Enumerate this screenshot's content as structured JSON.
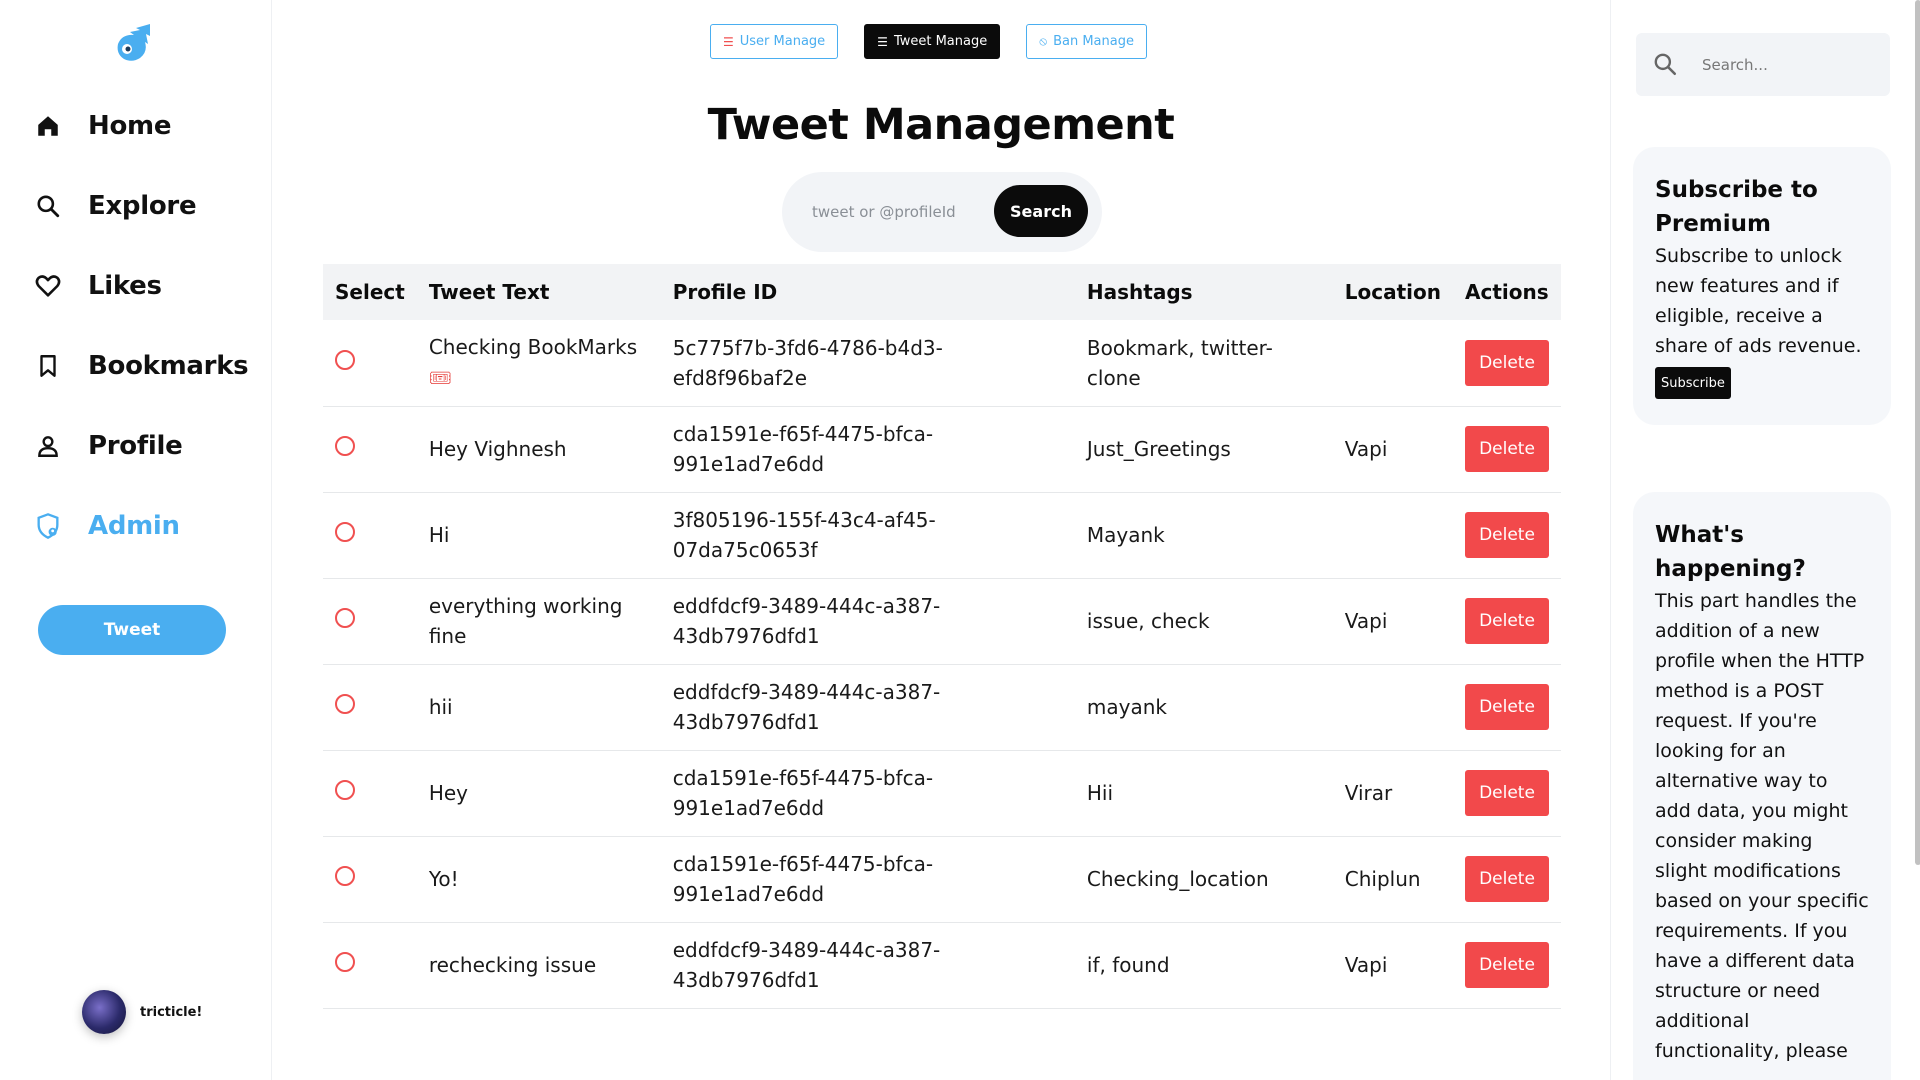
{
  "sidebar": {
    "nav": [
      {
        "label": "Home",
        "icon": "home-icon"
      },
      {
        "label": "Explore",
        "icon": "search-icon"
      },
      {
        "label": "Likes",
        "icon": "heart-icon"
      },
      {
        "label": "Bookmarks",
        "icon": "bookmark-icon"
      },
      {
        "label": "Profile",
        "icon": "user-icon"
      },
      {
        "label": "Admin",
        "icon": "admin-shield-icon",
        "active": true
      }
    ],
    "tweet_label": "Tweet",
    "username": "tricticle!"
  },
  "main": {
    "tabs": [
      {
        "label": "User Manage",
        "icon": "list-icon",
        "active": false
      },
      {
        "label": "Tweet Manage",
        "icon": "list-icon",
        "active": true
      },
      {
        "label": "Ban Manage",
        "icon": "ban-icon",
        "active": false
      }
    ],
    "title": "Tweet Management",
    "search": {
      "placeholder": "tweet or @profileId",
      "button": "Search"
    },
    "table": {
      "headers": [
        "Select",
        "Tweet Text",
        "Profile ID",
        "Hashtags",
        "Location",
        "Actions"
      ],
      "delete_label": "Delete",
      "rows": [
        {
          "text": "Checking BookMarks",
          "emoji": "🎟",
          "profile_id": "5c775f7b-3fd6-4786-b4d3-efd8f96baf2e",
          "hashtags": "Bookmark, twitter-clone",
          "location": ""
        },
        {
          "text": "Hey Vighnesh",
          "profile_id": "cda1591e-f65f-4475-bfca-991e1ad7e6dd",
          "hashtags": "Just_Greetings",
          "location": "Vapi"
        },
        {
          "text": "Hi",
          "profile_id": "3f805196-155f-43c4-af45-07da75c0653f",
          "hashtags": "Mayank",
          "location": ""
        },
        {
          "text": "everything working fine",
          "profile_id": "eddfdcf9-3489-444c-a387-43db7976dfd1",
          "hashtags": "issue, check",
          "location": "Vapi"
        },
        {
          "text": "hii",
          "profile_id": "eddfdcf9-3489-444c-a387-43db7976dfd1",
          "hashtags": "mayank",
          "location": ""
        },
        {
          "text": "Hey",
          "profile_id": "cda1591e-f65f-4475-bfca-991e1ad7e6dd",
          "hashtags": "Hii",
          "location": "Virar"
        },
        {
          "text": "Yo!",
          "profile_id": "cda1591e-f65f-4475-bfca-991e1ad7e6dd",
          "hashtags": "Checking_location",
          "location": "Chiplun"
        },
        {
          "text": "rechecking issue",
          "profile_id": "eddfdcf9-3489-444c-a387-43db7976dfd1",
          "hashtags": "if, found",
          "location": "Vapi"
        }
      ]
    }
  },
  "right": {
    "search_placeholder": "Search...",
    "premium": {
      "title": "Subscribe to Premium",
      "body": "Subscribe to unlock new features and if eligible, receive a share of ads revenue.",
      "button": "Subscribe"
    },
    "happening": {
      "title": "What's happening?",
      "body": "This part handles the addition of a new profile when the HTTP method is a POST request. If you're looking for an alternative way to add data, you might consider making slight modifications based on your specific requirements. If you have a different data structure or need additional functionality, please"
    }
  },
  "colors": {
    "accent": "#4aaef0",
    "danger": "#f2494b",
    "dark": "#0b0b0b"
  }
}
